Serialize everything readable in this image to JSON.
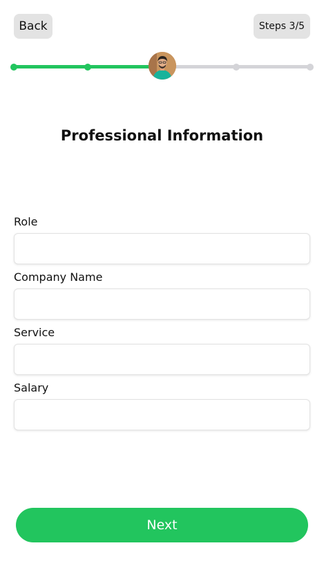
{
  "header": {
    "back_label": "Back",
    "steps_label": "Steps 3/5"
  },
  "progress": {
    "current_step": 3,
    "total_steps": 5,
    "completed_color": "#22c55e",
    "pending_color": "#d4d4d8",
    "current_marker": "user-avatar"
  },
  "page": {
    "title": "Professional Information"
  },
  "form": {
    "fields": [
      {
        "label": "Role",
        "value": "",
        "placeholder": ""
      },
      {
        "label": "Company Name",
        "value": "",
        "placeholder": ""
      },
      {
        "label": "Service",
        "value": "",
        "placeholder": ""
      },
      {
        "label": "Salary",
        "value": "",
        "placeholder": ""
      }
    ]
  },
  "footer": {
    "next_label": "Next",
    "accent_color": "#22c55e"
  }
}
